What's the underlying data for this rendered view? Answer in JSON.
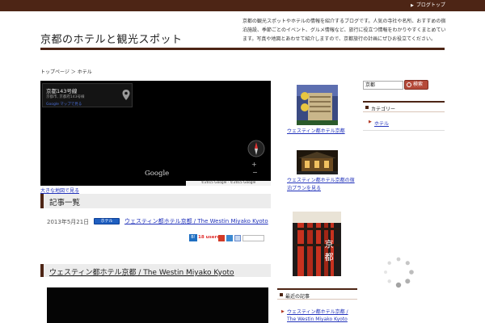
{
  "topbar": {
    "link_label": "ブログトップ"
  },
  "header": {
    "site_title": "京都のホテルと観光スポット",
    "site_description": "京都の観光スポットやホテルの情報を紹介するブログです。人気の寺社や名所、おすすめの宿泊施設、季節ごとのイベント、グルメ情報など、旅行に役立つ情報をわかりやすくまとめています。写真や地図とあわせて紹介しますので、京都旅行の計画にぜひお役立てください。"
  },
  "breadcrumb": "トップページ ＞ ホテル",
  "map": {
    "card_title": "京都143号線",
    "card_address": "京都市, 京都府143号線",
    "card_link": "Google マップで見る",
    "logo": "Google",
    "credit": "©2015 Google · ©2015 Google",
    "below_link": "大きな地図で見る"
  },
  "section": {
    "heading": "記事一覧"
  },
  "post": {
    "date": "2013年5月21日",
    "category": "ホテル",
    "title_link": "ウェスティン都ホテル京都 / The Westin Miyako Kyoto"
  },
  "share": {
    "hatena_label": "B!",
    "count_label": "18 users"
  },
  "post_heading": "ウェスティン都ホテル京都 / The Westin Miyako Kyoto",
  "middle": {
    "link1": "ウェスティン都ホテル京都",
    "link2": "ウェスティン都ホテル京都の宿泊プランを見る",
    "widget_title": "最近の記事",
    "list_item": "ウェスティン都ホテル京都 / The Westin Miyako Kyoto"
  },
  "sidebar": {
    "search_value": "京都",
    "search_button": "検索",
    "widget_title": "カテゴリー",
    "category_link": "ホテル"
  },
  "colors": {
    "brown": "#4d2515",
    "link": "#2233bb",
    "accent_red": "#b0341f",
    "map_bg": "#000000"
  }
}
